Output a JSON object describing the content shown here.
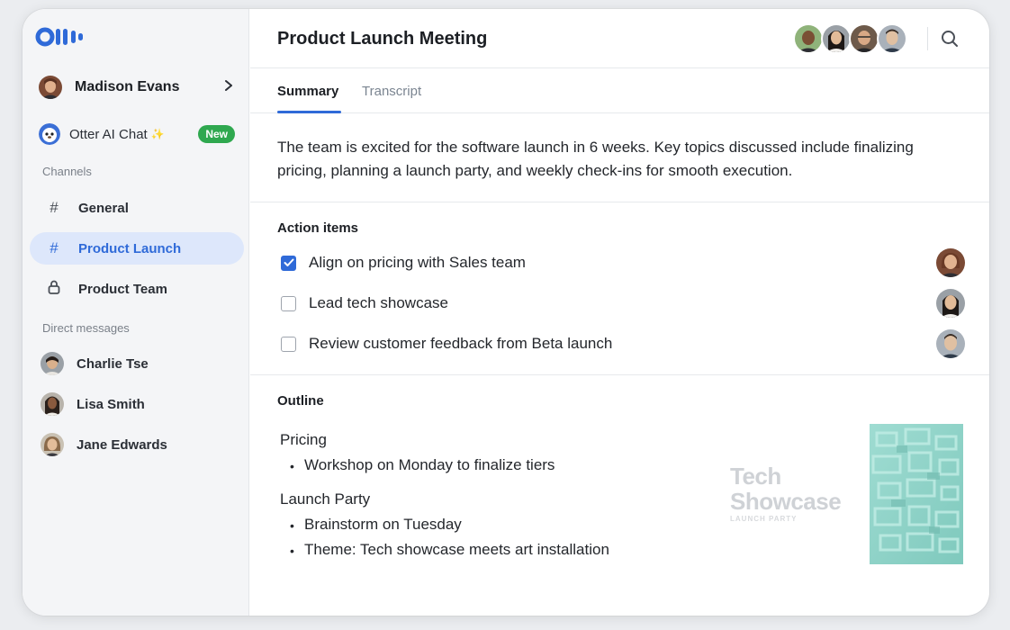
{
  "sidebar": {
    "user": {
      "name": "Madison Evans",
      "chevron": "›"
    },
    "otter_chat": {
      "label": "Otter AI Chat",
      "badge": "New",
      "sparkle_icon": "sparkle-icon"
    },
    "channels_label": "Channels",
    "channels": [
      {
        "label": "General",
        "icon": "hash-icon",
        "active": false
      },
      {
        "label": "Product Launch",
        "icon": "hash-icon",
        "active": true
      },
      {
        "label": "Product Team",
        "icon": "lock-icon",
        "active": false
      }
    ],
    "dm_label": "Direct messages",
    "direct_messages": [
      {
        "name": "Charlie Tse"
      },
      {
        "name": "Lisa Smith"
      },
      {
        "name": "Jane Edwards"
      }
    ]
  },
  "meeting": {
    "title": "Product Launch Meeting",
    "tabs": [
      {
        "label": "Summary",
        "active": true
      },
      {
        "label": "Transcript",
        "active": false
      }
    ],
    "summary": "The team is excited for the software launch in 6 weeks. Key topics discussed include finalizing pricing, planning a launch party, and weekly check-ins for smooth execution.",
    "action_items_heading": "Action items",
    "action_items": [
      {
        "text": "Align on pricing with Sales team",
        "checked": true
      },
      {
        "text": "Lead tech showcase",
        "checked": false
      },
      {
        "text": "Review customer feedback from Beta launch",
        "checked": false
      }
    ],
    "outline_heading": "Outline",
    "outline": [
      {
        "heading": "Pricing",
        "bullets": [
          "Workshop on Monday to finalize tiers"
        ]
      },
      {
        "heading": "Launch Party",
        "bullets": [
          "Brainstorm on Tuesday",
          "Theme: Tech showcase meets art installation"
        ]
      }
    ],
    "showcase": {
      "line1": "Tech",
      "line2": "Showcase",
      "line3": "LAUNCH PARTY"
    }
  },
  "colors": {
    "accent": "#2f6ad8",
    "active_nav_bg": "#dde7fb",
    "badge_green": "#2fa84f",
    "sidebar_bg": "#f4f5f7"
  }
}
